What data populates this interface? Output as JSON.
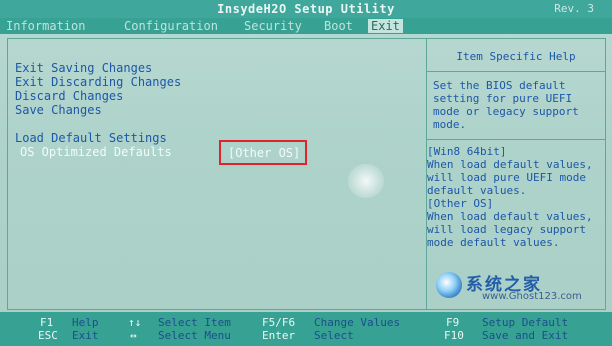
{
  "header": {
    "title": "InsydeH2O Setup Utility",
    "rev": "Rev. 3"
  },
  "tabs": [
    {
      "label": "Information"
    },
    {
      "label": "Configuration"
    },
    {
      "label": "Security"
    },
    {
      "label": "Boot"
    },
    {
      "label": "Exit"
    }
  ],
  "menu": {
    "items": [
      {
        "label": "Exit Saving Changes"
      },
      {
        "label": "Exit Discarding Changes"
      },
      {
        "label": "Discard Changes"
      },
      {
        "label": "Save Changes"
      },
      {
        "label": "Load Default Settings"
      },
      {
        "label": "OS Optimized Defaults"
      }
    ],
    "os_optimized_value": "[Other OS]"
  },
  "help": {
    "title": "Item Specific Help",
    "lines1": [
      "Set the BIOS default",
      "setting for pure UEFI",
      "mode or legacy support",
      "mode."
    ],
    "lines2": [
      "[Win8 64bit]",
      "When load default values,",
      " will load pure UEFI mode",
      " default values.",
      "[Other OS]",
      "When load default values,",
      " will load legacy support",
      " mode default values."
    ]
  },
  "watermark": {
    "title": "系统之家",
    "url": "www.Ghost123.com"
  },
  "keys": {
    "f1": "F1",
    "f1_desc": "Help",
    "esc": "ESC",
    "esc_desc": "Exit",
    "updown": "↑↓",
    "updown_desc": "Select Item",
    "leftright": "↔",
    "leftright_desc": "Select Menu",
    "f5f6": "F5/F6",
    "f5f6_desc": "Change Values",
    "enter": "Enter",
    "enter_desc": "Select",
    "f9": "F9",
    "f9_desc": "Setup Default",
    "f10": "F10",
    "f10_desc": "Save and Exit"
  }
}
